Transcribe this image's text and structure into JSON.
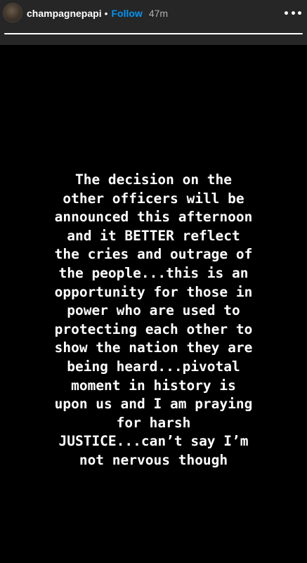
{
  "header": {
    "username": "champagnepapi",
    "separator": "•",
    "follow_label": "Follow",
    "timestamp": "47m"
  },
  "story": {
    "progress": 1.0,
    "text": "The decision on the\nother officers will be\nannounced this afternoon\nand it BETTER reflect\nthe cries and outrage of\nthe people...this is an\nopportunity for those in\npower who are used to\nprotecting each other to\nshow the nation they are\nbeing heard...pivotal\nmoment in history is\nupon us and I am praying\nfor harsh\nJUSTICE...can’t say I’m\nnot nervous though"
  },
  "icons": {
    "more": "more-options-icon",
    "avatar": "profile-avatar"
  },
  "colors": {
    "background": "#000000",
    "header": "#262626",
    "follow": "#0095f6",
    "text": "#ffffff"
  }
}
